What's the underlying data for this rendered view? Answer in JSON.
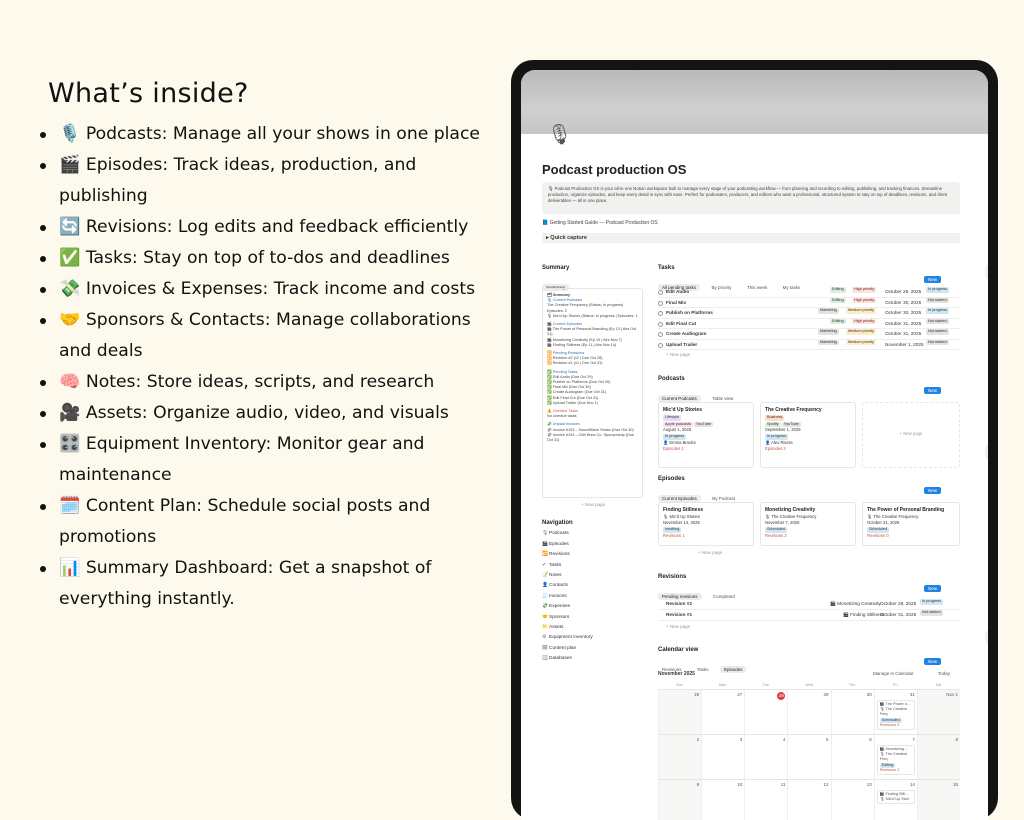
{
  "left": {
    "heading": "What’s inside?",
    "features": [
      {
        "emoji": "🎙️",
        "text": "Podcasts: Manage all your shows in one place"
      },
      {
        "emoji": "🎬",
        "text": "Episodes: Track ideas, production, and publishing"
      },
      {
        "emoji": "🔄",
        "text": "Revisions: Log edits and feedback efficiently"
      },
      {
        "emoji": "✅",
        "text": "Tasks: Stay on top of to-dos and deadlines"
      },
      {
        "emoji": "💸",
        "text": "Invoices & Expenses: Track income and costs"
      },
      {
        "emoji": "🤝",
        "text": "Sponsors & Contacts: Manage collaborations and deals"
      },
      {
        "emoji": "🧠",
        "text": "Notes: Store ideas, scripts, and research"
      },
      {
        "emoji": "🎥",
        "text": "Assets: Organize audio, video, and visuals"
      },
      {
        "emoji": "🎛️",
        "text": "Equipment Inventory: Monitor gear and maintenance"
      },
      {
        "emoji": "🗓️",
        "text": "Content Plan: Schedule social posts and promotions"
      },
      {
        "emoji": "📊",
        "text": "Summary Dashboard: Get a snapshot of everything instantly."
      }
    ]
  },
  "app": {
    "page_icon": "🎙",
    "title": "Podcast production OS",
    "callout": "🎙 Podcast Production OS is your all-in-one Notion workspace built to manage every stage of your podcasting workflow — from planning and recording to editing, publishing, and tracking finances. Streamline production, organize episodes, and keep every detail in sync with ease. Perfect for podcasters, producers, and editors who want a professional, structured system to stay on top of deadlines, revisions, and client deliverables — all in one place.",
    "guide_link": "📘 Getting Started Guide — Podcast Production OS",
    "quick_capture": "▸  Quick capture",
    "new_page": "+ New page",
    "new_button": "New",
    "summary": {
      "heading": "Summary",
      "tab": "Summary",
      "lines": [
        {
          "t": "🗂 Summary",
          "c": "b"
        },
        {
          "t": "🎙 Current Podcasts",
          "c": "blue"
        },
        {
          "t": "The Creative Frequency (Status: In progress)",
          "c": ""
        },
        {
          "t": "Episodes: 2",
          "c": ""
        },
        {
          "t": "🎙 Mic'd Up Stories (Status: In progress | Episodes: 1",
          "c": ""
        },
        {
          "t": "",
          "c": ""
        },
        {
          "t": "🎬 Current Episodes",
          "c": "blue"
        },
        {
          "t": "🎬 The Power of Personal Branding (Ep 13 | Airs Oct 31)",
          "c": ""
        },
        {
          "t": "🎬 Monetizing Creativity (Ep 19 | Airs Nov 7)",
          "c": ""
        },
        {
          "t": "🎬 Finding Stillness (Ep 11 | Airs Nov 14)",
          "c": ""
        },
        {
          "t": "",
          "c": ""
        },
        {
          "t": "🔁 Pending Revisions",
          "c": "blue"
        },
        {
          "t": "🔁 Revision #2 (v2 | Due Oct 28)",
          "c": ""
        },
        {
          "t": "🔁 Revision #1 (v1 | Due Oct 31)",
          "c": ""
        },
        {
          "t": "",
          "c": ""
        },
        {
          "t": "✅ Pending Tasks",
          "c": "blue"
        },
        {
          "t": "✅ Edit Audio (Due Oct 29)",
          "c": ""
        },
        {
          "t": "✅ Publish on Platforms (Due Oct 30)",
          "c": ""
        },
        {
          "t": "✅ Final Mix (Due Oct 30)",
          "c": ""
        },
        {
          "t": "✅ Create Audiogram (Due Oct 31)",
          "c": ""
        },
        {
          "t": "✅ Edit Final Cut (Due Oct 31)",
          "c": ""
        },
        {
          "t": "✅ Upload Trailer (Due Nov 1)",
          "c": ""
        },
        {
          "t": "",
          "c": ""
        },
        {
          "t": "⚠️ Overdue Tasks",
          "c": "red"
        },
        {
          "t": "No overdue tasks",
          "c": ""
        },
        {
          "t": "",
          "c": ""
        },
        {
          "t": "💸 Unpaid Invoices",
          "c": "blue"
        },
        {
          "t": "💸 Invoice #103 – SoundWave Studio (Due Oct 30)",
          "c": ""
        },
        {
          "t": "💸 Invoice #104 – Chill Brew Co. Sponsorship (Due Oct 31)",
          "c": ""
        }
      ]
    },
    "navigation": {
      "heading": "Navigation",
      "items": [
        {
          "icon": "🎙",
          "label": "Podcasts"
        },
        {
          "icon": "🎬",
          "label": "Episodes"
        },
        {
          "icon": "🔁",
          "label": "Revisions"
        },
        {
          "icon": "✔",
          "label": "Tasks"
        },
        {
          "icon": "📝",
          "label": "Notes"
        },
        {
          "icon": "👤",
          "label": "Contacts"
        },
        {
          "icon": "🧾",
          "label": "Invoices"
        },
        {
          "icon": "💸",
          "label": "Expenses"
        },
        {
          "icon": "🤝",
          "label": "Sponsors"
        },
        {
          "icon": "📁",
          "label": "Assets"
        },
        {
          "icon": "⚙",
          "label": "Equipment inventory"
        },
        {
          "icon": "🗓",
          "label": "Content plan"
        },
        {
          "icon": "🗄",
          "label": "Databases"
        }
      ]
    },
    "tasks": {
      "heading": "Tasks",
      "tabs": [
        "All pending tasks",
        "By priority",
        "This week",
        "My tasks"
      ],
      "rows": [
        {
          "name": "Edit Audio",
          "stage": "Editing",
          "priority": "High priority",
          "date": "October 29, 2025",
          "status": "In progress"
        },
        {
          "name": "Final Mix",
          "stage": "Editing",
          "priority": "High priority",
          "date": "October 30, 2025",
          "status": "Not started"
        },
        {
          "name": "Publish on Platforms",
          "stage": "Marketing",
          "priority": "Medium priority",
          "date": "October 30, 2025",
          "status": "In progress"
        },
        {
          "name": "Edit Final Cut",
          "stage": "Editing",
          "priority": "High priority",
          "date": "October 31, 2025",
          "status": "Not started"
        },
        {
          "name": "Create Audiogram",
          "stage": "Marketing",
          "priority": "Medium priority",
          "date": "October 31, 2025",
          "status": "Not started"
        },
        {
          "name": "Upload Trailer",
          "stage": "Marketing",
          "priority": "Medium priority",
          "date": "November 1, 2025",
          "status": "Not started"
        }
      ]
    },
    "podcasts": {
      "heading": "Podcasts",
      "tabs": [
        "Current Podcasts",
        "Table view"
      ],
      "cards": [
        {
          "title": "Mic'd Up Stories",
          "tag1": "Lifestyle",
          "tag2": "Apple podcasts",
          "tag3": "YouTube",
          "date": "August 1, 2025",
          "status": "In progress",
          "person": "👤 Emma Brooks",
          "episodes": "Episodes 1"
        },
        {
          "title": "The Creative Frequency",
          "tag1": "Business",
          "tag2": "Spotify",
          "tag3": "YouTube",
          "date": "September 1, 2025",
          "status": "In progress",
          "person": "👤 Alex Rivera",
          "episodes": "Episodes 2"
        }
      ]
    },
    "episodes": {
      "heading": "Episodes",
      "tabs": [
        "Current Episodes",
        "By Podcast"
      ],
      "cards": [
        {
          "title": "Finding Stillness",
          "show": "🎙 Mic'd Up Stories",
          "date": "November 14, 2025",
          "status": "Inediting",
          "rev": "Revisions 1"
        },
        {
          "title": "Monetizing Creativity",
          "show": "🎙 The Creative Frequency",
          "date": "November 7, 2025",
          "status": "Scheduled",
          "rev": "Revisions 2"
        },
        {
          "title": "The Power of Personal Branding",
          "show": "🎙 The Creative Frequency",
          "date": "October 31, 2025",
          "status": "Scheduled",
          "rev": "Revisions 0"
        }
      ]
    },
    "revisions": {
      "heading": "Revisions",
      "tabs": [
        "Pending revisions",
        "Completed"
      ],
      "rows": [
        {
          "name": "Revision #2",
          "episode": "🎬 Monetizing Creativity",
          "date": "October 28, 2025",
          "status": "In progress"
        },
        {
          "name": "Revision #1",
          "episode": "🎬 Finding Stillness",
          "date": "October 31, 2025",
          "status": "Not started"
        }
      ]
    },
    "calendar": {
      "heading": "Calendar view",
      "tabs": [
        "Revisions",
        "Tasks",
        "Episodes"
      ],
      "month": "November 2025",
      "manage": "Manage in Calendar",
      "today_btn": "Today",
      "days": [
        "Sun",
        "Mon",
        "Tue",
        "Wed",
        "Thu",
        "Fri",
        "Sat"
      ],
      "weeks": [
        [
          "26",
          "27",
          "28",
          "29",
          "30",
          "31",
          "Nov 1"
        ],
        [
          "2",
          "3",
          "4",
          "5",
          "6",
          "7",
          "8"
        ],
        [
          "9",
          "10",
          "11",
          "12",
          "13",
          "14",
          "15"
        ]
      ],
      "events": [
        {
          "title": "🎬 The Power o...",
          "show": "🎙 The Creative Freq",
          "status": "Scheduled",
          "rev": "Revisions 0"
        },
        {
          "title": "🎬 Monetizing ...",
          "show": "🎙 The Creative Freq",
          "status": "Editing",
          "rev": "Revisions 2"
        },
        {
          "title": "🎬 Finding Still...",
          "show": "🎙 Mic'd Up Stori"
        }
      ]
    }
  }
}
